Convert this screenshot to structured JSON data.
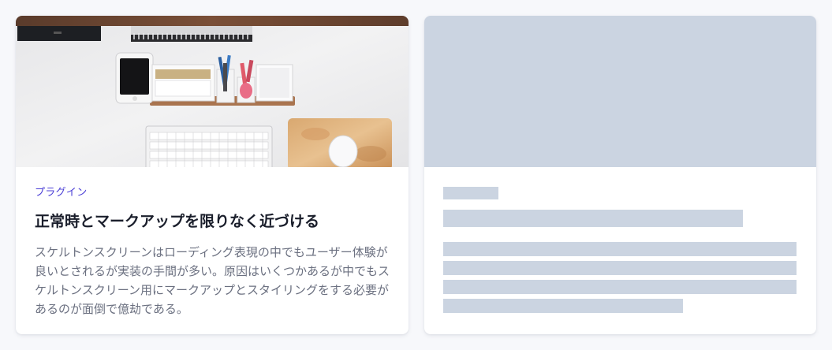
{
  "article_card": {
    "category": "プラグイン",
    "title": "正常時とマークアップを限りなく近づける",
    "description": "スケルトンスクリーンはローディング表現の中でもユーザー体験が良いとされるが実装の手間が多い。原因はいくつかあるが中でもスケルトンスクリーン用にマークアップとスタイリングをする必要があるのが面倒で億劫である。",
    "image_subject": "desk-photo"
  },
  "colors": {
    "page_background": "#f7f8fb",
    "card_background": "#ffffff",
    "category_accent": "#4b3fd6",
    "title_text": "#1a1e2b",
    "body_text": "#6b7080",
    "skeleton": "#cbd4e1"
  }
}
